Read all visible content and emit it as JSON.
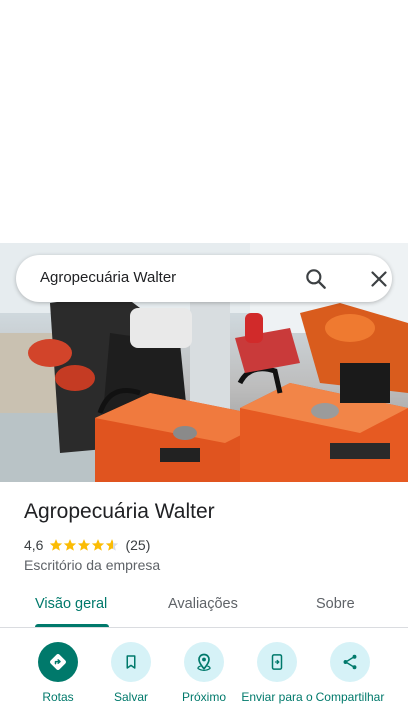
{
  "search": {
    "query": "Agropecuária Walter",
    "search_icon": "search-icon",
    "close_icon": "close-icon"
  },
  "place": {
    "name": "Agropecuária Walter",
    "rating": "4,6",
    "rating_value": 4.6,
    "review_count": "(25)",
    "category": "Escritório da empresa"
  },
  "tabs": [
    {
      "label": "Visão geral",
      "active": true
    },
    {
      "label": "Avaliações",
      "active": false
    },
    {
      "label": "Sobre",
      "active": false
    }
  ],
  "actions": [
    {
      "label": "Rotas",
      "icon": "directions-icon"
    },
    {
      "label": "Salvar",
      "icon": "bookmark-icon"
    },
    {
      "label": "Próximo",
      "icon": "nearby-icon"
    },
    {
      "label": "Enviar para o",
      "icon": "send-to-phone-icon"
    },
    {
      "label": "Compartilhar",
      "icon": "share-icon"
    }
  ],
  "colors": {
    "accent": "#00796b",
    "action_bg": "#d6f2f7",
    "star": "#fbbc04"
  }
}
